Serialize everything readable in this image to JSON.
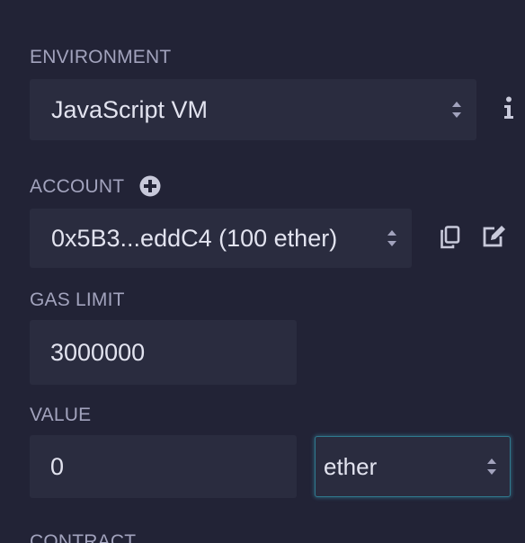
{
  "environment": {
    "label": "ENVIRONMENT",
    "selected": "JavaScript VM",
    "info_icon": "info-icon"
  },
  "account": {
    "label": "ACCOUNT",
    "add_icon": "plus-circle-icon",
    "selected": "0x5B3...eddC4 (100 ether)",
    "copy_icon": "copy-icon",
    "edit_icon": "edit-icon"
  },
  "gas_limit": {
    "label": "GAS LIMIT",
    "value": "3000000"
  },
  "value": {
    "label": "VALUE",
    "amount": "0",
    "unit": "ether"
  },
  "contract": {
    "label": "CONTRACT"
  },
  "colors": {
    "background": "#222336",
    "field": "#2a2c3f",
    "label": "#a2a3bd",
    "text": "#e2e3ef",
    "focus_border": "#2f7a8f"
  }
}
